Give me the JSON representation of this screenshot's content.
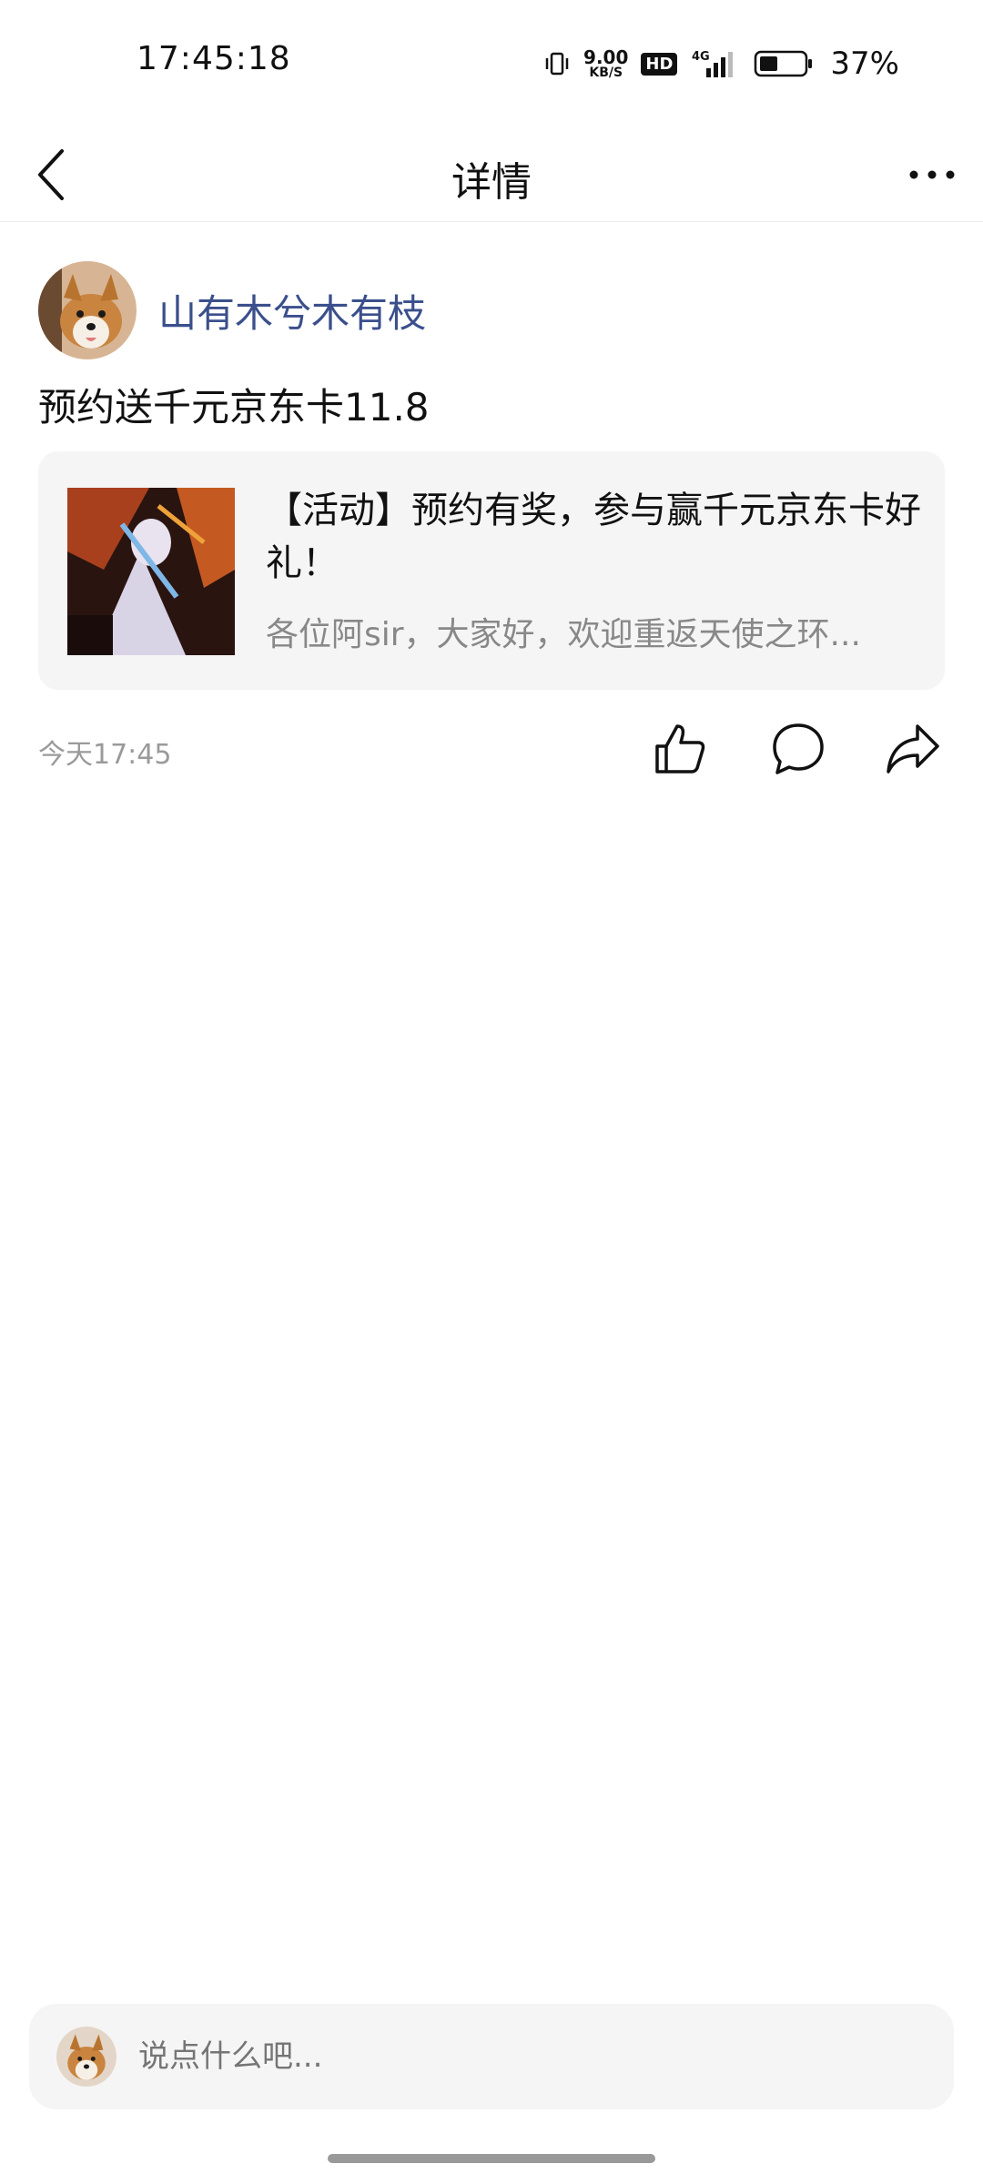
{
  "status_bar": {
    "time": "17:45:18",
    "net_speed_value": "9.00",
    "net_speed_unit": "KB/S",
    "hd_label": "HD",
    "network": "4G",
    "battery_pct": "37%"
  },
  "header": {
    "title": "详情",
    "back_icon": "chevron-left-icon",
    "more_icon": "more-horizontal-icon"
  },
  "post": {
    "author_name": "山有木兮木有枝",
    "text": "预约送千元京东卡11.8",
    "card": {
      "title": "【活动】预约有奖，参与赢千元京东卡好礼！",
      "description": "各位阿sir，大家好，欢迎重返天使之环..."
    },
    "time": "今天17:45",
    "actions": [
      "thumbs-up-icon",
      "comment-icon",
      "share-icon"
    ]
  },
  "comment_bar": {
    "placeholder": "说点什么吧..."
  },
  "colors": {
    "author_name": "#3b4f8c",
    "card_bg": "#f5f5f5",
    "muted_text": "#888888"
  }
}
